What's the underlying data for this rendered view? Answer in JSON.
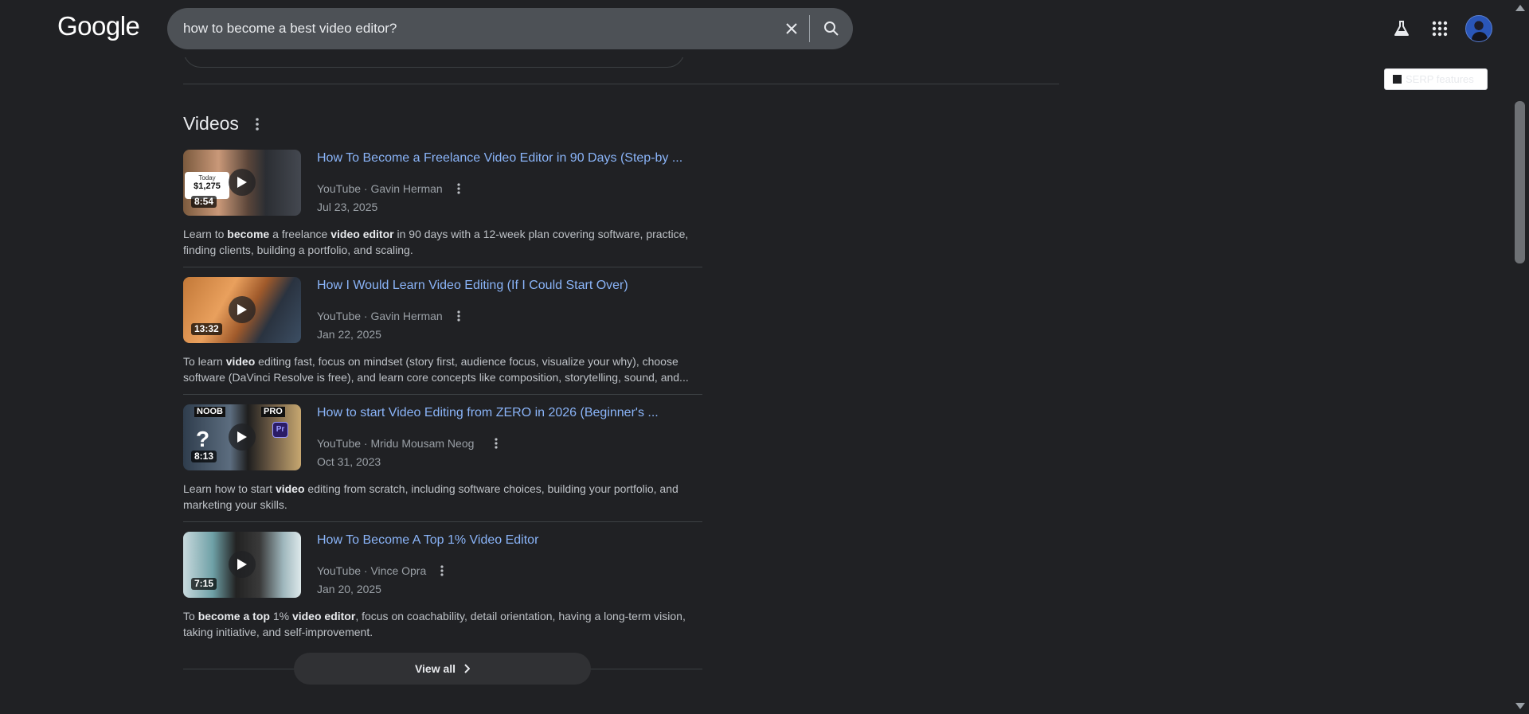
{
  "header": {
    "logo_text": "Google",
    "search_value": "how to become a best video editor?",
    "clear_icon": "close-icon",
    "search_icon": "search-icon",
    "labs_icon": "flask-icon",
    "apps_icon": "apps-grid-icon",
    "avatar_icon": "account-avatar"
  },
  "serp_features": {
    "label": "SERP features"
  },
  "videos": {
    "title": "Videos",
    "items": [
      {
        "title": "How To Become a Freelance Video Editor in 90 Days (Step-by ...",
        "source": "YouTube · Gavin Herman",
        "date": "Jul 23, 2025",
        "duration": "8:54",
        "thumb_badge_small": "Today",
        "thumb_badge_amount": "$1,275",
        "desc_parts": [
          "Learn to ",
          "become",
          " a freelance ",
          "video editor",
          " in 90 days with a 12-week plan covering software, practice, finding clients, building a portfolio, and scaling."
        ]
      },
      {
        "title": "How I Would Learn Video Editing (If I Could Start Over)",
        "source": "YouTube · Gavin Herman",
        "date": "Jan 22, 2025",
        "duration": "13:32",
        "desc_parts": [
          "To learn ",
          "video",
          " editing fast, focus on mindset (story first, audience focus, visualize your why), choose software (DaVinci Resolve is free), and learn core concepts like composition, storytelling, sound, and..."
        ]
      },
      {
        "title": "How to start Video Editing from ZERO in 2026 (Beginner's ...",
        "source": "YouTube · Mridu Mousam Neog",
        "date": "Oct 31, 2023",
        "duration": "8:13",
        "thumb_noob": "NOOB",
        "thumb_pro": "PRO",
        "thumb_q": "?",
        "thumb_pr": "Pr",
        "desc_parts": [
          "Learn how to start ",
          "video",
          " editing from scratch, including software choices, building your portfolio, and marketing your skills."
        ]
      },
      {
        "title": "How To Become A Top 1% Video Editor",
        "source": "YouTube · Vince Opra",
        "date": "Jan 20, 2025",
        "duration": "7:15",
        "desc_parts": [
          "To ",
          "become a top",
          " 1% ",
          "video editor",
          ", focus on coachability, detail orientation, having a long-term vision, taking initiative, and self-improvement."
        ]
      }
    ],
    "view_all": "View all"
  },
  "colors": {
    "background": "#202124",
    "link": "#8ab4f8",
    "muted": "#9aa0a6",
    "search_box": "#4d5156"
  }
}
